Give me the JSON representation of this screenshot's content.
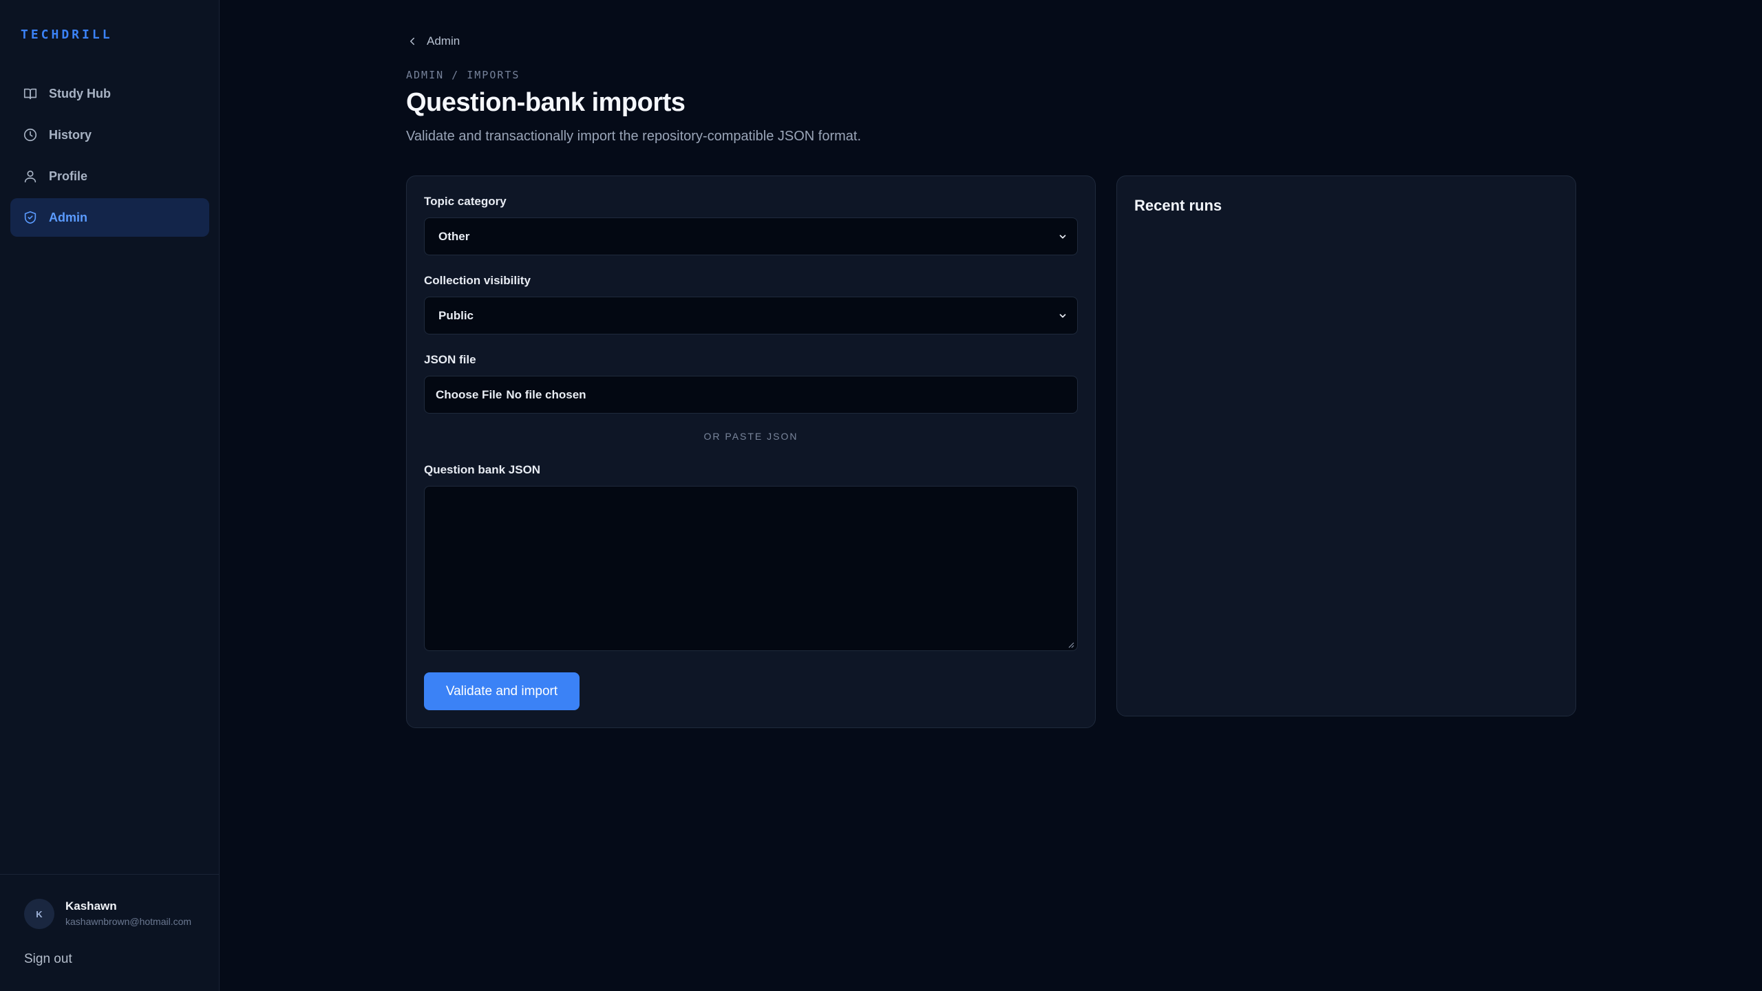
{
  "brand": "TECHDRILL",
  "nav": {
    "items": [
      {
        "label": "Study Hub",
        "icon": "book-icon",
        "active": false
      },
      {
        "label": "History",
        "icon": "clock-icon",
        "active": false
      },
      {
        "label": "Profile",
        "icon": "user-icon",
        "active": false
      },
      {
        "label": "Admin",
        "icon": "shield-icon",
        "active": true
      }
    ]
  },
  "user": {
    "initial": "K",
    "name": "Kashawn",
    "email": "kashawnbrown@hotmail.com",
    "sign_out": "Sign out"
  },
  "header": {
    "back_label": "Admin",
    "breadcrumb": "ADMIN / IMPORTS",
    "title": "Question-bank imports",
    "subtitle": "Validate and transactionally import the repository-compatible JSON format."
  },
  "form": {
    "topic_label": "Topic category",
    "topic_value": "Other",
    "visibility_label": "Collection visibility",
    "visibility_value": "Public",
    "file_label": "JSON file",
    "file_button": "Choose File",
    "file_status": "No file chosen",
    "or_divider": "OR PASTE JSON",
    "json_label": "Question bank JSON",
    "json_value": "",
    "submit_label": "Validate and import"
  },
  "runs": {
    "title": "Recent runs"
  },
  "colors": {
    "background": "#050b18",
    "sidebar": "#0b1322",
    "card": "#0e1626",
    "accent": "#3b82f6",
    "active_nav_bg": "#13254a"
  }
}
